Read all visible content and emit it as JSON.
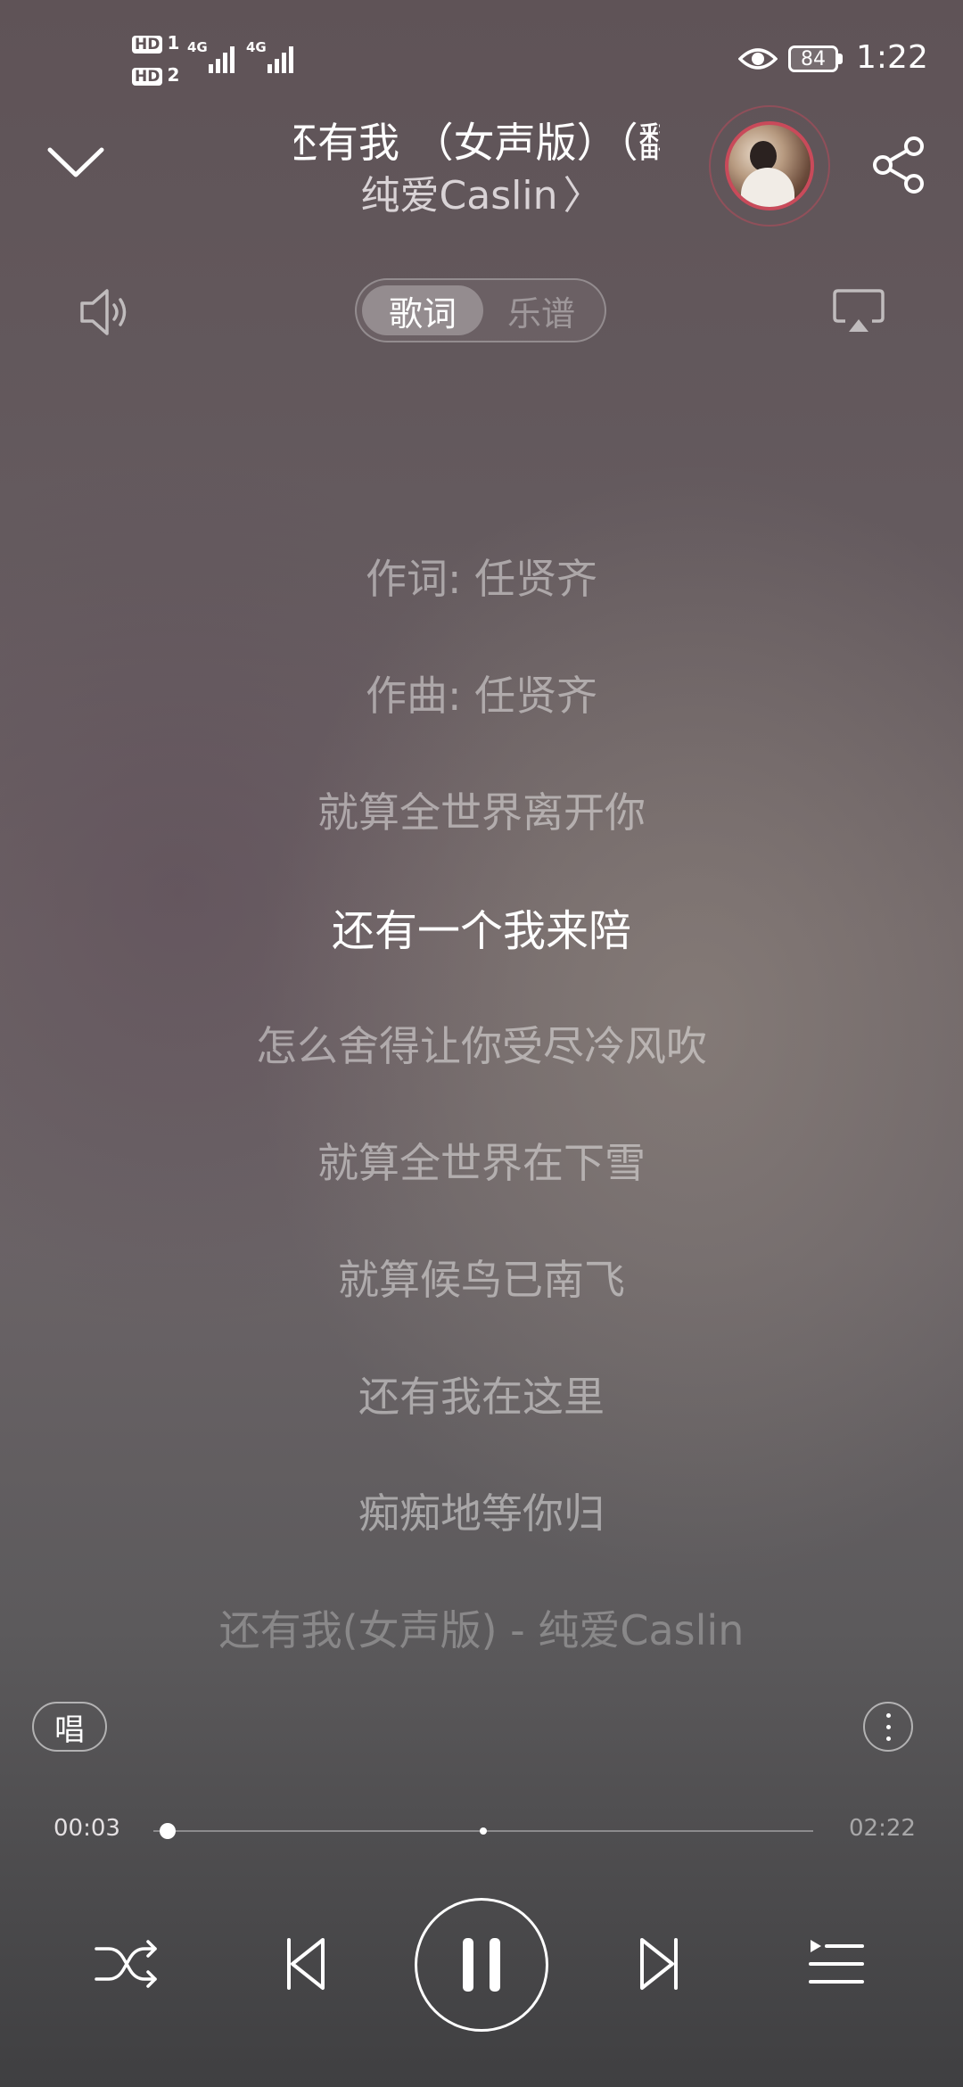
{
  "status_bar": {
    "hd1": "HD",
    "sim1": "1",
    "hd2": "HD",
    "sim2": "2",
    "net1": "4G",
    "net2": "4G",
    "battery": "84",
    "time": "1:22"
  },
  "header": {
    "title": "还有我 （女声版）（翻",
    "artist": "纯爱Caslin",
    "artist_chevron": "〉"
  },
  "toggle": {
    "lyrics": "歌词",
    "score": "乐谱"
  },
  "lyrics": [
    "作词: 任贤齐",
    "作曲: 任贤齐",
    "就算全世界离开你",
    "还有一个我来陪",
    "怎么舍得让你受尽冷风吹",
    "就算全世界在下雪",
    "就算候鸟已南飞",
    "还有我在这里",
    "痴痴地等你归",
    "还有我(女声版) - 纯爱Caslin"
  ],
  "current_lyric_index": 3,
  "sing_button": "唱",
  "progress": {
    "current": "00:03",
    "total": "02:22",
    "fraction": 0.021,
    "marker_fraction": 0.5
  },
  "icons": {
    "collapse": "chevron-down-icon",
    "share": "share-icon",
    "volume": "volume-icon",
    "cast": "cast-icon",
    "shuffle": "shuffle-icon",
    "previous": "previous-icon",
    "pause": "pause-icon",
    "next": "next-icon",
    "playlist": "playlist-icon",
    "more": "more-vertical-icon"
  },
  "colors": {
    "accent_ring": "#c94a5a"
  }
}
